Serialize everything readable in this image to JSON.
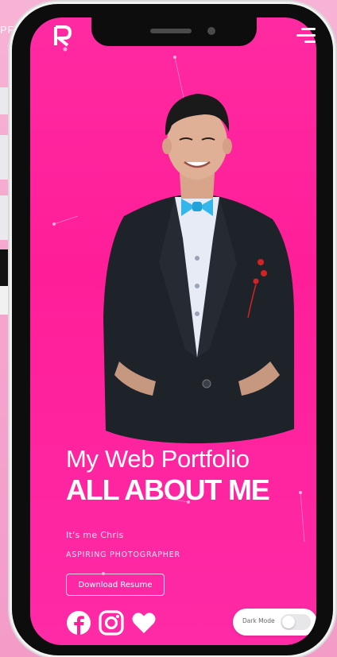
{
  "background": {
    "brand_partial": "PF"
  },
  "header": {
    "logo_icon": "r-logo-icon",
    "menu_icon": "hamburger-menu-icon"
  },
  "hero": {
    "title_line1": "My Web Portfolio",
    "title_line2": "ALL ABOUT ME",
    "intro": "It's me Chris",
    "role": "ASPIRING PHOTOGRAPHER",
    "resume_button": "Download Resume"
  },
  "social": [
    {
      "icon": "facebook-icon"
    },
    {
      "icon": "instagram-icon"
    },
    {
      "icon": "heart-icon"
    }
  ],
  "theme_toggle": {
    "label": "Dark Mode",
    "enabled": false
  },
  "colors": {
    "accent": "#ff1e98",
    "text": "#ffffff"
  }
}
